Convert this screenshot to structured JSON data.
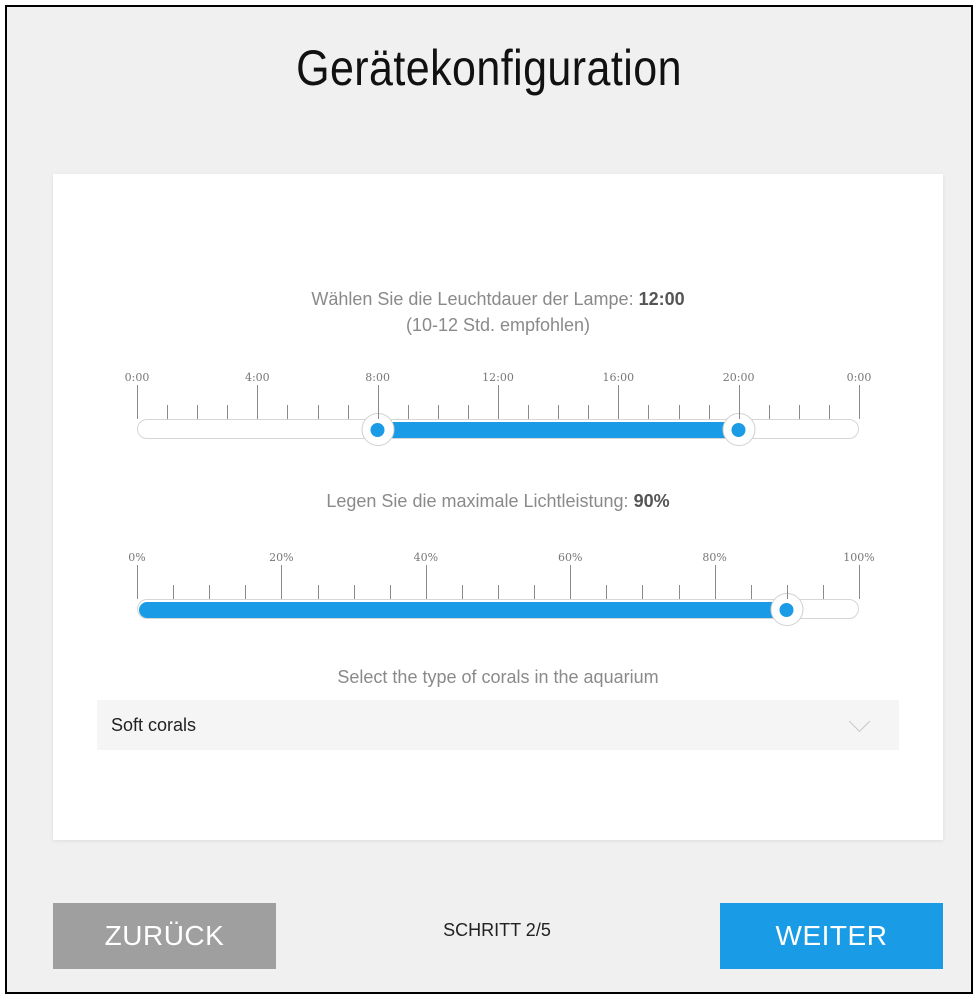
{
  "page": {
    "title": "Gerätekonfiguration"
  },
  "duration": {
    "label_prefix": "Wählen Sie die Leuchtdauer der Lampe:",
    "value": "12:00",
    "recommendation": "(10-12 Std. empfohlen)",
    "tick_labels": [
      "0:00",
      "4:00",
      "8:00",
      "12:00",
      "16:00",
      "20:00",
      "0:00"
    ],
    "range_start_hours": 8,
    "range_end_hours": 20,
    "scale_max_hours": 24
  },
  "power": {
    "label_prefix": "Legen Sie die maximale Lichtleistung:",
    "value": "90%",
    "tick_labels": [
      "0%",
      "20%",
      "40%",
      "60%",
      "80%",
      "100%"
    ],
    "level_percent": 90
  },
  "corals": {
    "label": "Select the type of corals in the aquarium",
    "selected": "Soft corals"
  },
  "footer": {
    "back_label": "ZURÜCK",
    "step_label": "SCHRITT 2/5",
    "next_label": "WEITER"
  },
  "colors": {
    "accent": "#1a9be6",
    "back_button": "#9f9f9f",
    "background": "#f0f0f0"
  }
}
